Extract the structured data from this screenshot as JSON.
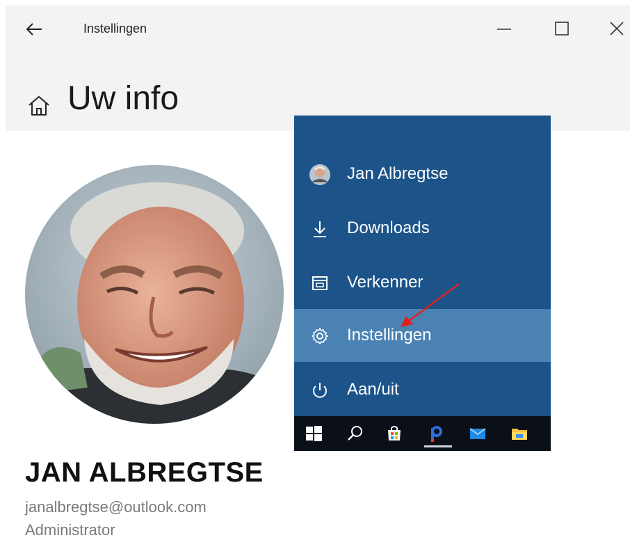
{
  "window": {
    "app_title": "Instellingen",
    "page_title": "Uw info"
  },
  "user": {
    "name": "JAN ALBREGTSE",
    "email": "janalbregtse@outlook.com",
    "role": "Administrator"
  },
  "start_menu": {
    "items": [
      {
        "label": "Jan Albregtse",
        "icon": "user-avatar"
      },
      {
        "label": "Downloads",
        "icon": "download-icon"
      },
      {
        "label": "Verkenner",
        "icon": "file-explorer-icon"
      },
      {
        "label": "Instellingen",
        "icon": "gear-icon",
        "highlighted": true
      },
      {
        "label": "Aan/uit",
        "icon": "power-icon"
      }
    ],
    "taskbar": [
      "windows-start-icon",
      "search-icon",
      "store-icon",
      "app-icon",
      "mail-icon",
      "folder-icon"
    ]
  },
  "colors": {
    "menu_bg": "#1c5489",
    "menu_highlight": "#4a82b3",
    "taskbar_bg": "#0b1018",
    "annotation_arrow": "#e02020"
  }
}
